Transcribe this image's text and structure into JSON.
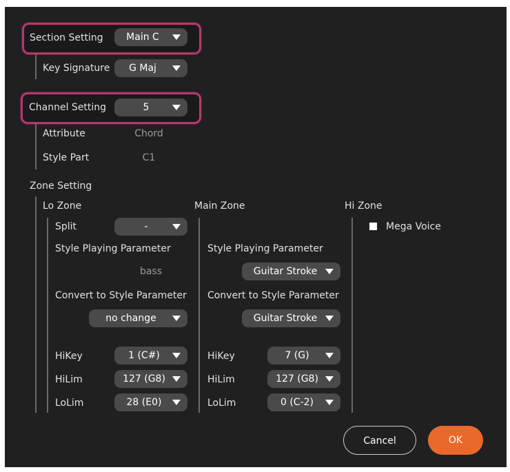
{
  "section_setting": {
    "label": "Section Setting",
    "value": "Main C"
  },
  "key_signature": {
    "label": "Key Signature",
    "value": "G Maj"
  },
  "channel_setting": {
    "label": "Channel Setting",
    "value": "5"
  },
  "attribute": {
    "label": "Attribute",
    "value": "Chord"
  },
  "style_part": {
    "label": "Style Part",
    "value": "C1"
  },
  "zone_setting": {
    "label": "Zone Setting",
    "lo_zone": {
      "title": "Lo Zone",
      "split_label": "Split",
      "split_value": "-",
      "style_playing_label": "Style Playing Parameter",
      "style_playing_value": "bass",
      "convert_label": "Convert to Style Parameter",
      "convert_value": "no change",
      "hikey_label": "HiKey",
      "hikey_value": "1 (C#)",
      "hilim_label": "HiLim",
      "hilim_value": "127 (G8)",
      "lolim_label": "LoLim",
      "lolim_value": "28 (E0)"
    },
    "main_zone": {
      "title": "Main Zone",
      "style_playing_label": "Style Playing Parameter",
      "style_playing_value": "Guitar Stroke",
      "convert_label": "Convert to Style Parameter",
      "convert_value": "Guitar Stroke",
      "hikey_label": "HiKey",
      "hikey_value": "7 (G)",
      "hilim_label": "HiLim",
      "hilim_value": "127 (G8)",
      "lolim_label": "LoLim",
      "lolim_value": "0 (C-2)"
    },
    "hi_zone": {
      "title": "Hi Zone",
      "mega_voice_label": "Mega Voice",
      "mega_voice_checked": true
    }
  },
  "buttons": {
    "cancel": "Cancel",
    "ok": "OK"
  },
  "colors": {
    "panel": "#202020",
    "dropdown": "#4a4a4a",
    "highlight": "#b23a6c",
    "ok": "#e8692a"
  }
}
